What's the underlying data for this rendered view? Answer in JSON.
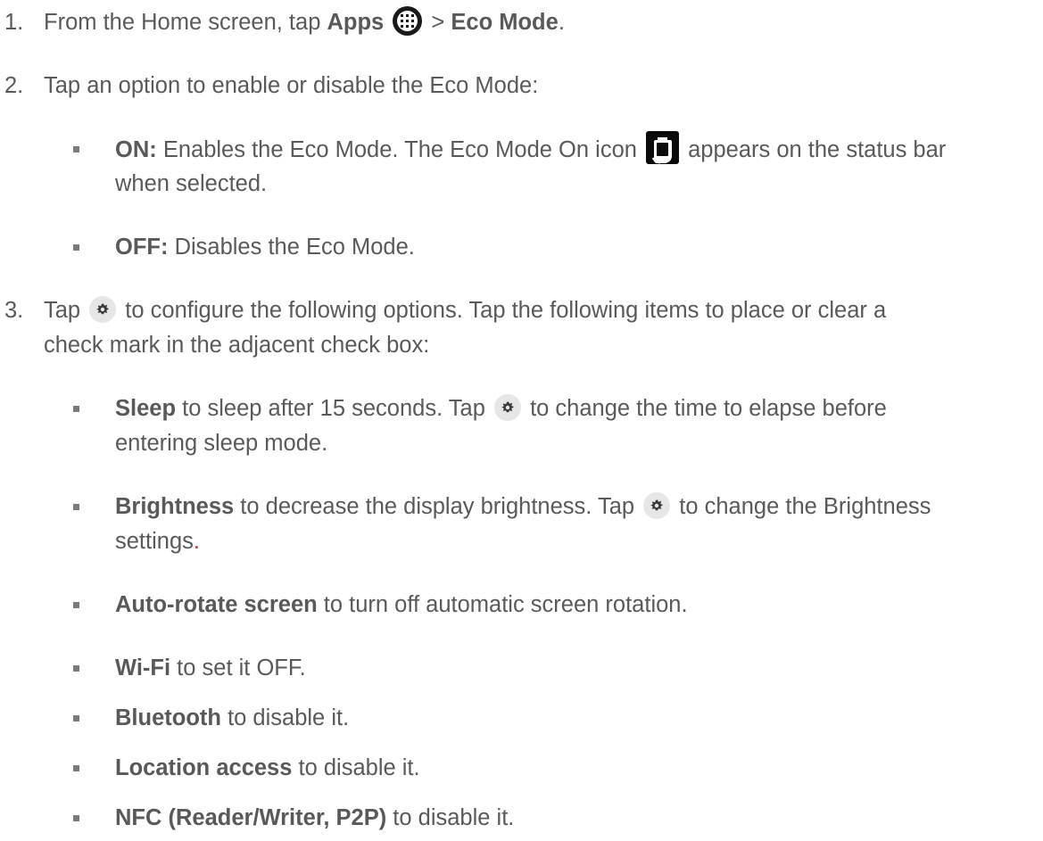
{
  "step1": {
    "number": "1.",
    "text_a": "From the Home screen, tap ",
    "apps": "Apps",
    "sep": " > ",
    "eco_mode": "Eco Mode",
    "end": ".",
    "apps_icon": "apps-grid-icon"
  },
  "step2": {
    "number": "2.",
    "text": "Tap an option to enable or disable the Eco Mode:"
  },
  "on_item": {
    "label": "ON:",
    "text_a": " Enables the Eco Mode. The Eco Mode On icon ",
    "text_b": " appears on the status bar",
    "text_c": "when selected.",
    "icon": "eco-mode-battery-icon"
  },
  "off_item": {
    "label": "OFF:",
    "text": " Disables the Eco Mode."
  },
  "step3": {
    "number": "3.",
    "text_a": "Tap ",
    "text_b": " to configure the following options. Tap the following items to place or clear a",
    "text_c": "check mark in the adjacent check box:",
    "icon": "gear-icon"
  },
  "sleep_item": {
    "label": "Sleep",
    "text_a": " to sleep after 15 seconds. Tap ",
    "text_b": " to change the time to elapse before",
    "text_c": "entering sleep mode."
  },
  "brightness_item": {
    "label": "Brightness",
    "text_a": " to decrease the display brightness. Tap ",
    "text_b": " to change the Brightness",
    "text_c": "settings",
    "text_d": "."
  },
  "autorotate_item": {
    "label": "Auto-rotate screen",
    "text": " to turn off automatic screen rotation."
  },
  "wifi_item": {
    "label": "Wi-Fi",
    "text": " to set it OFF."
  },
  "bluetooth_item": {
    "label": "Bluetooth",
    "text": " to disable it."
  },
  "location_item": {
    "label": "Location access",
    "text": " to disable it."
  },
  "nfc_item": {
    "label": "NFC (Reader/Writer, P2P)",
    "text": " to disable it."
  },
  "colors": {
    "text": "#595959",
    "icon_dark": "#0a0a0a",
    "gear_bg": "#e6e6e6"
  }
}
